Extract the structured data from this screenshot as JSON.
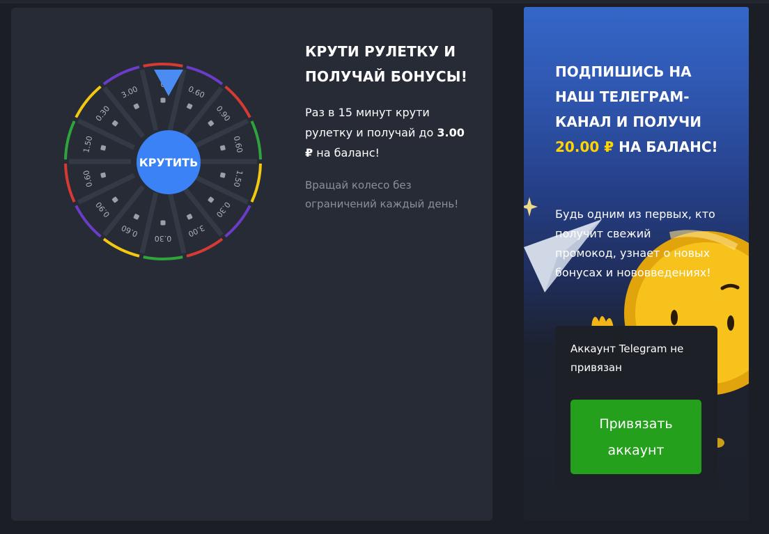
{
  "wheel": {
    "spin_label": "КРУТИТЬ",
    "segments": [
      "0.60",
      "0.90",
      "0.60",
      "1.50",
      "0.30",
      "3.00",
      "0.30",
      "0.60",
      "0.90",
      "0.60",
      "1.50",
      "0.30",
      "3.00",
      "0"
    ],
    "rim_colors": [
      "#f2c811",
      "#6a3cc7",
      "#d63a35",
      "#2fa33c"
    ],
    "accent": "#3b82f6"
  },
  "bonus": {
    "title": "КРУТИ РУЛЕТКУ И ПОЛУЧАЙ БОНУСЫ!",
    "desc_before": "Раз в 15 минут крути рулетку и получай до",
    "desc_amount": "3.00 ₽",
    "desc_after": "на баланс!",
    "note": "Вращай колесо без ограничений каждый день!"
  },
  "promo": {
    "title_before": "ПОДПИШИСЬ НА НАШ ТЕЛЕГРАМ-КАНАЛ И ПОЛУЧИ",
    "title_amount": "20.00 ₽",
    "title_after": "НА БАЛАНС!",
    "desc": "Будь одним из первых, кто получит свежий промокод, узнает о новых бонусах и нововведениях!",
    "status": "Аккаунт Telegram не привязан",
    "button": "Привязать аккаунт",
    "accent": "#ffd400",
    "button_color": "#25a01d"
  }
}
